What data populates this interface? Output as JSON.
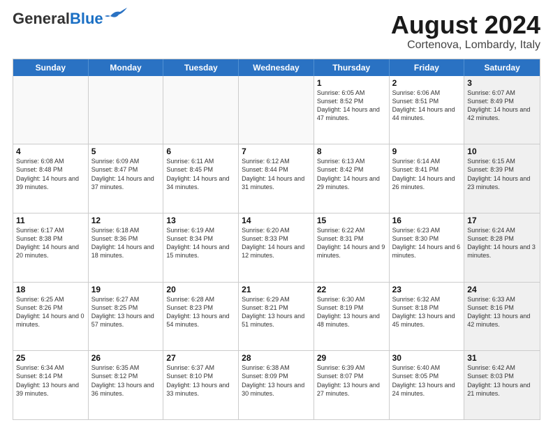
{
  "header": {
    "logo_general": "General",
    "logo_blue": "Blue",
    "title": "August 2024",
    "subtitle": "Cortenova, Lombardy, Italy"
  },
  "weekdays": [
    "Sunday",
    "Monday",
    "Tuesday",
    "Wednesday",
    "Thursday",
    "Friday",
    "Saturday"
  ],
  "rows": [
    [
      {
        "day": "",
        "info": "",
        "empty": true
      },
      {
        "day": "",
        "info": "",
        "empty": true
      },
      {
        "day": "",
        "info": "",
        "empty": true
      },
      {
        "day": "",
        "info": "",
        "empty": true
      },
      {
        "day": "1",
        "info": "Sunrise: 6:05 AM\nSunset: 8:52 PM\nDaylight: 14 hours\nand 47 minutes."
      },
      {
        "day": "2",
        "info": "Sunrise: 6:06 AM\nSunset: 8:51 PM\nDaylight: 14 hours\nand 44 minutes."
      },
      {
        "day": "3",
        "info": "Sunrise: 6:07 AM\nSunset: 8:49 PM\nDaylight: 14 hours\nand 42 minutes.",
        "shaded": true
      }
    ],
    [
      {
        "day": "4",
        "info": "Sunrise: 6:08 AM\nSunset: 8:48 PM\nDaylight: 14 hours\nand 39 minutes."
      },
      {
        "day": "5",
        "info": "Sunrise: 6:09 AM\nSunset: 8:47 PM\nDaylight: 14 hours\nand 37 minutes."
      },
      {
        "day": "6",
        "info": "Sunrise: 6:11 AM\nSunset: 8:45 PM\nDaylight: 14 hours\nand 34 minutes."
      },
      {
        "day": "7",
        "info": "Sunrise: 6:12 AM\nSunset: 8:44 PM\nDaylight: 14 hours\nand 31 minutes."
      },
      {
        "day": "8",
        "info": "Sunrise: 6:13 AM\nSunset: 8:42 PM\nDaylight: 14 hours\nand 29 minutes."
      },
      {
        "day": "9",
        "info": "Sunrise: 6:14 AM\nSunset: 8:41 PM\nDaylight: 14 hours\nand 26 minutes."
      },
      {
        "day": "10",
        "info": "Sunrise: 6:15 AM\nSunset: 8:39 PM\nDaylight: 14 hours\nand 23 minutes.",
        "shaded": true
      }
    ],
    [
      {
        "day": "11",
        "info": "Sunrise: 6:17 AM\nSunset: 8:38 PM\nDaylight: 14 hours\nand 20 minutes."
      },
      {
        "day": "12",
        "info": "Sunrise: 6:18 AM\nSunset: 8:36 PM\nDaylight: 14 hours\nand 18 minutes."
      },
      {
        "day": "13",
        "info": "Sunrise: 6:19 AM\nSunset: 8:34 PM\nDaylight: 14 hours\nand 15 minutes."
      },
      {
        "day": "14",
        "info": "Sunrise: 6:20 AM\nSunset: 8:33 PM\nDaylight: 14 hours\nand 12 minutes."
      },
      {
        "day": "15",
        "info": "Sunrise: 6:22 AM\nSunset: 8:31 PM\nDaylight: 14 hours\nand 9 minutes."
      },
      {
        "day": "16",
        "info": "Sunrise: 6:23 AM\nSunset: 8:30 PM\nDaylight: 14 hours\nand 6 minutes."
      },
      {
        "day": "17",
        "info": "Sunrise: 6:24 AM\nSunset: 8:28 PM\nDaylight: 14 hours\nand 3 minutes.",
        "shaded": true
      }
    ],
    [
      {
        "day": "18",
        "info": "Sunrise: 6:25 AM\nSunset: 8:26 PM\nDaylight: 14 hours\nand 0 minutes."
      },
      {
        "day": "19",
        "info": "Sunrise: 6:27 AM\nSunset: 8:25 PM\nDaylight: 13 hours\nand 57 minutes."
      },
      {
        "day": "20",
        "info": "Sunrise: 6:28 AM\nSunset: 8:23 PM\nDaylight: 13 hours\nand 54 minutes."
      },
      {
        "day": "21",
        "info": "Sunrise: 6:29 AM\nSunset: 8:21 PM\nDaylight: 13 hours\nand 51 minutes."
      },
      {
        "day": "22",
        "info": "Sunrise: 6:30 AM\nSunset: 8:19 PM\nDaylight: 13 hours\nand 48 minutes."
      },
      {
        "day": "23",
        "info": "Sunrise: 6:32 AM\nSunset: 8:18 PM\nDaylight: 13 hours\nand 45 minutes."
      },
      {
        "day": "24",
        "info": "Sunrise: 6:33 AM\nSunset: 8:16 PM\nDaylight: 13 hours\nand 42 minutes.",
        "shaded": true
      }
    ],
    [
      {
        "day": "25",
        "info": "Sunrise: 6:34 AM\nSunset: 8:14 PM\nDaylight: 13 hours\nand 39 minutes."
      },
      {
        "day": "26",
        "info": "Sunrise: 6:35 AM\nSunset: 8:12 PM\nDaylight: 13 hours\nand 36 minutes."
      },
      {
        "day": "27",
        "info": "Sunrise: 6:37 AM\nSunset: 8:10 PM\nDaylight: 13 hours\nand 33 minutes."
      },
      {
        "day": "28",
        "info": "Sunrise: 6:38 AM\nSunset: 8:09 PM\nDaylight: 13 hours\nand 30 minutes."
      },
      {
        "day": "29",
        "info": "Sunrise: 6:39 AM\nSunset: 8:07 PM\nDaylight: 13 hours\nand 27 minutes."
      },
      {
        "day": "30",
        "info": "Sunrise: 6:40 AM\nSunset: 8:05 PM\nDaylight: 13 hours\nand 24 minutes."
      },
      {
        "day": "31",
        "info": "Sunrise: 6:42 AM\nSunset: 8:03 PM\nDaylight: 13 hours\nand 21 minutes.",
        "shaded": true
      }
    ]
  ]
}
